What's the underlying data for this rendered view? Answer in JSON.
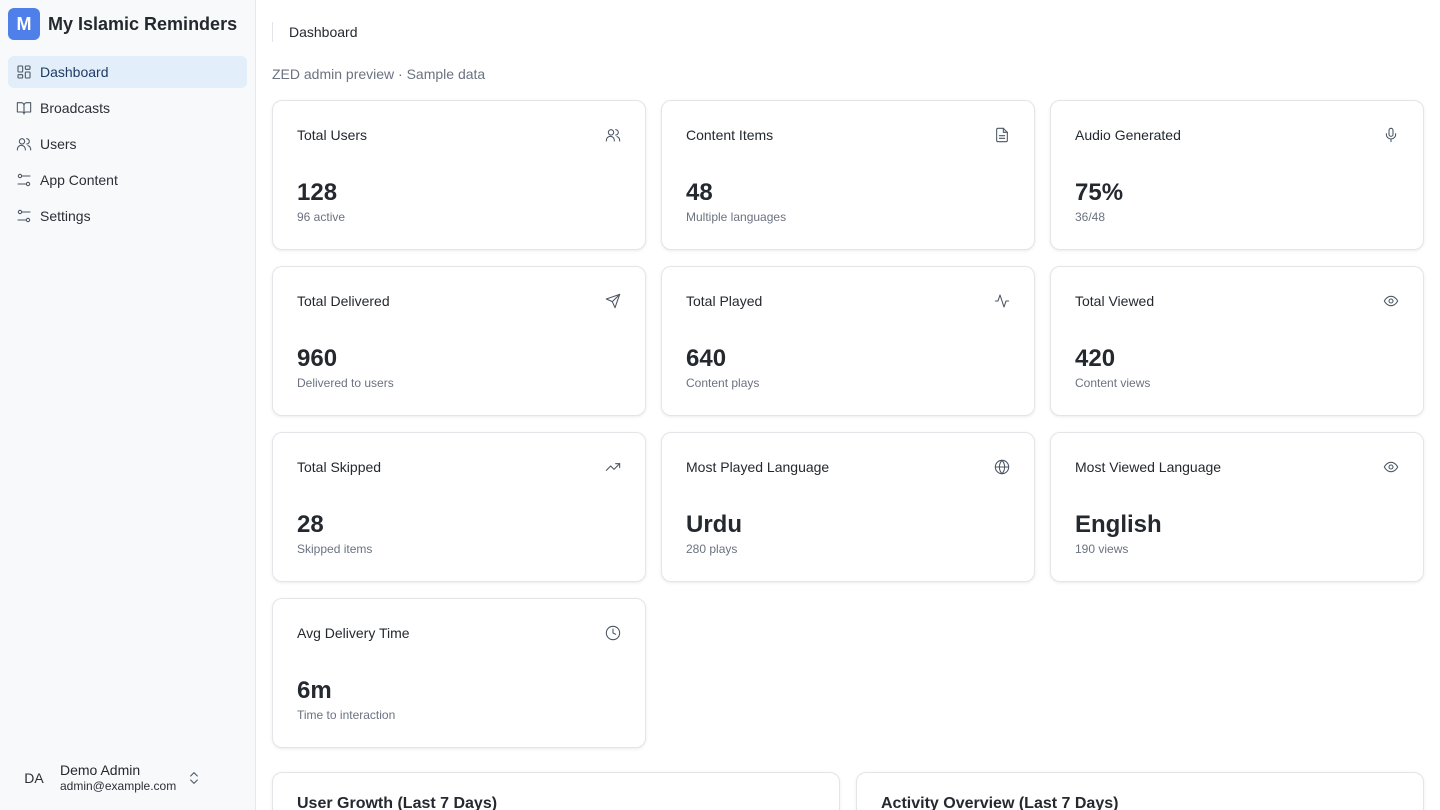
{
  "app": {
    "logo_letter": "M",
    "name": "My Islamic Reminders"
  },
  "sidebar": {
    "items": [
      {
        "label": "Dashboard",
        "icon": "dashboard-icon",
        "active": true
      },
      {
        "label": "Broadcasts",
        "icon": "book-icon",
        "active": false
      },
      {
        "label": "Users",
        "icon": "users-icon",
        "active": false
      },
      {
        "label": "App Content",
        "icon": "sliders-icon",
        "active": false
      },
      {
        "label": "Settings",
        "icon": "settings-sliders-icon",
        "active": false
      }
    ],
    "user": {
      "initials": "DA",
      "name": "Demo Admin",
      "email": "admin@example.com"
    }
  },
  "header": {
    "breadcrumb": "Dashboard",
    "subtitle": "ZED admin preview · Sample data"
  },
  "cards": [
    {
      "title": "Total Users",
      "value": "128",
      "sub": "96 active",
      "icon": "users-icon"
    },
    {
      "title": "Content Items",
      "value": "48",
      "sub": "Multiple languages",
      "icon": "document-icon"
    },
    {
      "title": "Audio Generated",
      "value": "75%",
      "sub": "36/48",
      "icon": "microphone-icon"
    },
    {
      "title": "Total Delivered",
      "value": "960",
      "sub": "Delivered to users",
      "icon": "send-icon"
    },
    {
      "title": "Total Played",
      "value": "640",
      "sub": "Content plays",
      "icon": "activity-icon"
    },
    {
      "title": "Total Viewed",
      "value": "420",
      "sub": "Content views",
      "icon": "eye-icon"
    },
    {
      "title": "Total Skipped",
      "value": "28",
      "sub": "Skipped items",
      "icon": "trending-up-icon"
    },
    {
      "title": "Most Played Language",
      "value": "Urdu",
      "sub": "280 plays",
      "icon": "globe-icon"
    },
    {
      "title": "Most Viewed Language",
      "value": "English",
      "sub": "190 views",
      "icon": "eye-icon"
    },
    {
      "title": "Avg Delivery Time",
      "value": "6m",
      "sub": "Time to interaction",
      "icon": "clock-icon"
    }
  ],
  "panels": [
    {
      "title": "User Growth (Last 7 Days)"
    },
    {
      "title": "Activity Overview (Last 7 Days)"
    }
  ]
}
